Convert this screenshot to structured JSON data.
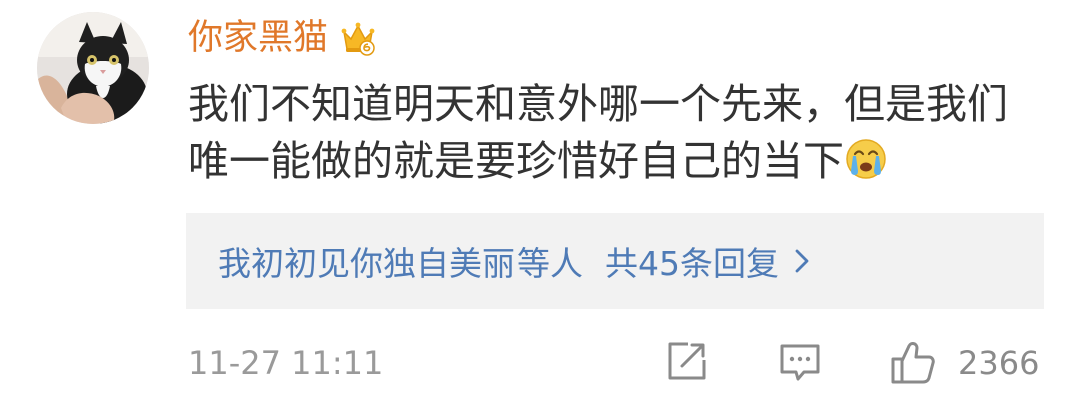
{
  "comment": {
    "username": "你家黑猫",
    "text": "我们不知道明天和意外哪一个先来，但是我们唯一能做的就是要珍惜好自己的当下",
    "badge_icon": "crown-icon",
    "emoji_icon": "crying-emoji-icon",
    "username_color": "#e0782a",
    "text_color": "#333333"
  },
  "replies": {
    "users": "我初初见你独自美丽",
    "suffix": "等人",
    "count_label": "共45条回复",
    "link_color": "#4f7bb6",
    "background_color": "#f2f2f2"
  },
  "meta": {
    "timestamp": "11-27 11:11",
    "likes": "2366",
    "icons": [
      "share-icon",
      "comment-icon",
      "like-icon"
    ],
    "muted_color": "#9a9a9a"
  }
}
